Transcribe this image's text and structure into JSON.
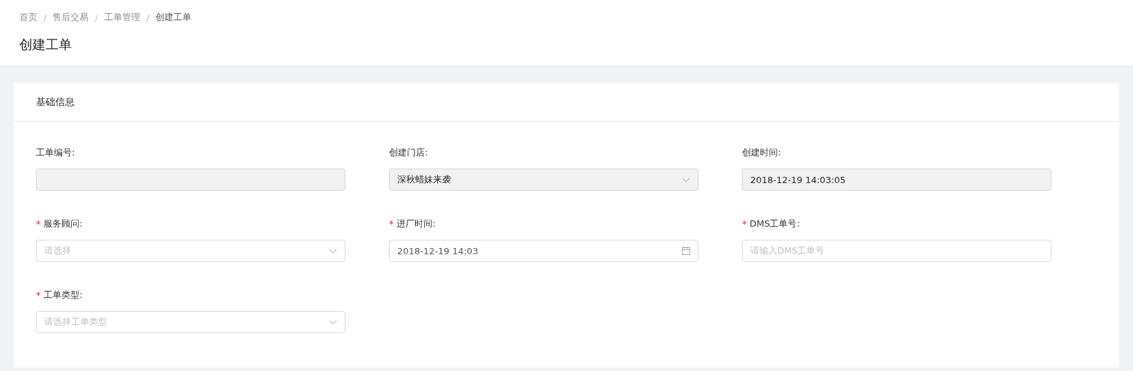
{
  "breadcrumb": [
    {
      "label": "首页",
      "current": false
    },
    {
      "label": "售后交易",
      "current": false
    },
    {
      "label": "工单管理",
      "current": false
    },
    {
      "label": "创建工单",
      "current": true
    }
  ],
  "breadcrumb_separator": "/",
  "page_title": "创建工单",
  "card": {
    "title": "基础信息",
    "fields": [
      {
        "label": "工单编号:",
        "kind": "text",
        "required": false,
        "disabled": true
      },
      {
        "label": "创建门店:",
        "kind": "select",
        "required": false,
        "disabled": true,
        "value": "深秋蜡妹来袭"
      },
      {
        "label": "创建时间:",
        "kind": "text",
        "required": false,
        "disabled": true,
        "value": "2018-12-19 14:03:05"
      },
      {
        "label": "服务顾问:",
        "kind": "select",
        "required": true,
        "disabled": false,
        "placeholder": "请选择"
      },
      {
        "label": "进厂时间:",
        "kind": "date",
        "required": true,
        "disabled": false,
        "value": "2018-12-19 14:03"
      },
      {
        "label": "DMS工单号:",
        "kind": "text",
        "required": true,
        "disabled": false,
        "placeholder": "请输入DMS工单号"
      },
      {
        "label": "工单类型:",
        "kind": "select",
        "required": true,
        "disabled": false,
        "placeholder": "请选择工单类型"
      }
    ]
  },
  "required_mark": "*"
}
